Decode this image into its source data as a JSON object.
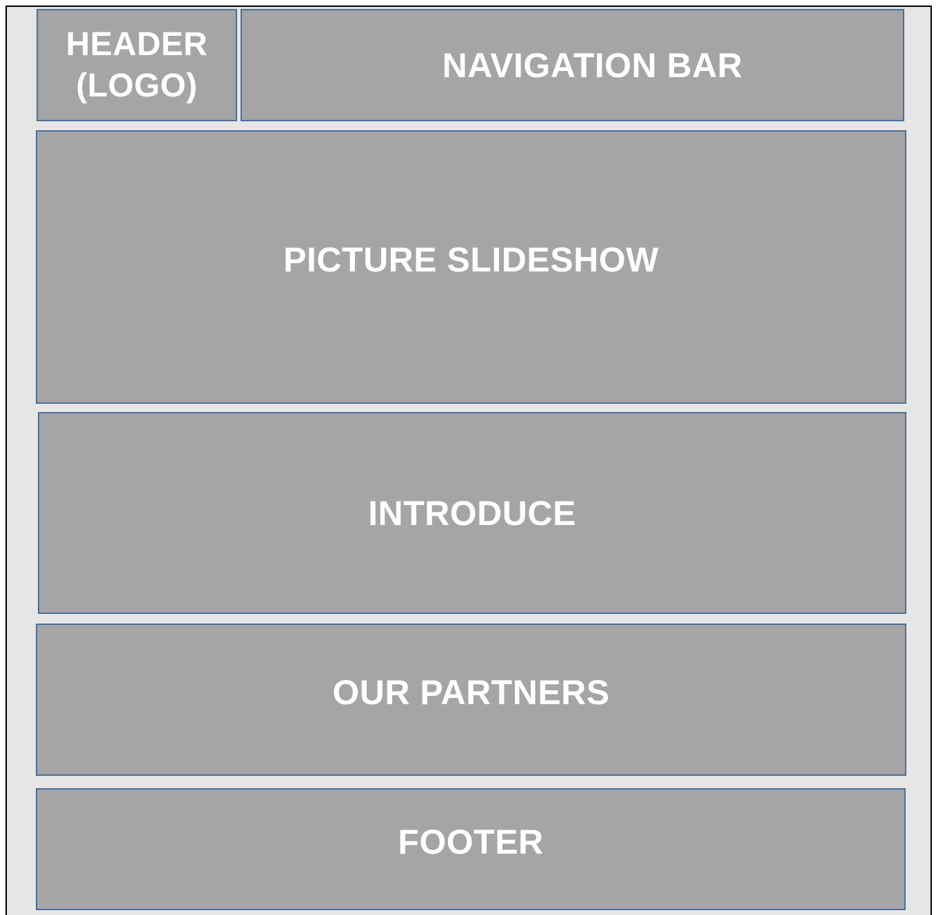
{
  "wireframe": {
    "header": {
      "line1": "HEADER",
      "line2": "(LOGO)"
    },
    "navigation": {
      "label": "NAVIGATION BAR"
    },
    "slideshow": {
      "label": "PICTURE SLIDESHOW"
    },
    "introduce": {
      "label": "INTRODUCE"
    },
    "partners": {
      "label": "OUR PARTNERS"
    },
    "footer": {
      "label": "FOOTER"
    }
  },
  "colors": {
    "block_fill": "#a5a5a5",
    "block_border": "#4a6f97",
    "background": "#e6e6e6",
    "text": "#ffffff"
  }
}
